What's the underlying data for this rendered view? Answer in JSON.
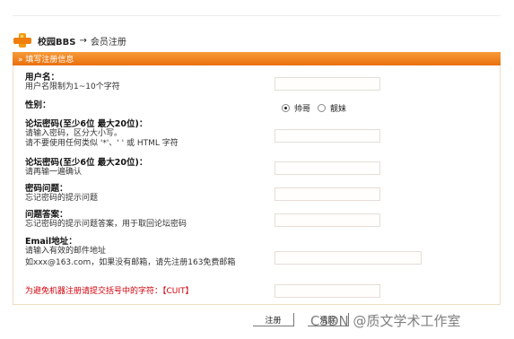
{
  "breadcrumb": {
    "home": "校园BBS",
    "arrow": "→",
    "current": "会员注册"
  },
  "panel": {
    "header": "» 填写注册信息"
  },
  "fields": {
    "username": {
      "label": "用户名：",
      "hint": "用户名限制为1~10个字符"
    },
    "gender": {
      "label": "性别：",
      "options": [
        "帅哥",
        "靓妹"
      ],
      "selected": "帅哥"
    },
    "password": {
      "label": "论坛密码(至少6位 最大20位)：",
      "hint1": "请输入密码，区分大小写。",
      "hint2": "请不要使用任何类似 '*'、' ' 或 HTML 字符"
    },
    "confirm": {
      "label": "论坛密码(至少6位 最大20位)：",
      "hint": "请再输一遍确认"
    },
    "question": {
      "label": "密码问题：",
      "hint": "忘记密码的提示问题"
    },
    "answer": {
      "label": "问题答案：",
      "hint": "忘记密码的提示问题答案，用于取回论坛密码"
    },
    "email": {
      "label": "Email地址：",
      "hint1": "请输入有效的邮件地址",
      "hint2": "如xxx@163.com，如果没有邮箱，请先注册163免费邮箱"
    },
    "captcha": {
      "label": "为避免机器注册请提交括号中的字符：【CUIT】"
    }
  },
  "buttons": {
    "submit": "注册",
    "reset": "清除"
  },
  "watermark": "CSDN @质文学术工作室"
}
